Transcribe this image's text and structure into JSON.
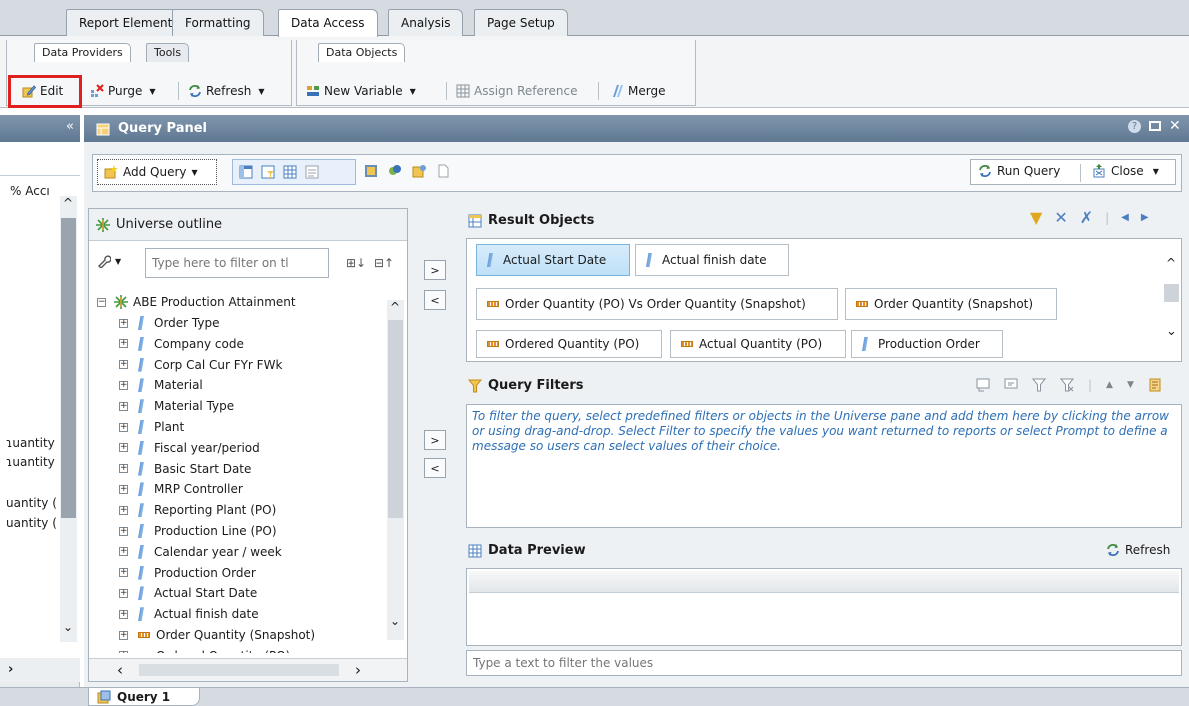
{
  "ribbon_tabs": [
    "Report Elements",
    "Formatting",
    "Data Access",
    "Analysis",
    "Page Setup"
  ],
  "group_tabs": {
    "data_providers": "Data Providers",
    "tools": "Tools",
    "data_objects": "Data Objects"
  },
  "ribbon_buttons": {
    "edit": "Edit",
    "purge": "Purge",
    "refresh": "Refresh",
    "new_variable": "New Variable",
    "assign_reference": "Assign Reference",
    "merge": "Merge"
  },
  "left_pane": {
    "collapse_glyph": "«",
    "labels": [
      "% Accı",
      "ɿuantity",
      "ɿuantity",
      "uantity (",
      "uantity ("
    ]
  },
  "query_panel": {
    "title": "Query Panel",
    "add_query": "Add Query",
    "run_query": "Run Query",
    "close": "Close",
    "universe": {
      "title": "Universe outline",
      "filter_placeholder": "Type here to filter on tl",
      "root": "ABE Production Attainment",
      "items": [
        {
          "label": "Order Type",
          "kind": "dimension"
        },
        {
          "label": "Company code",
          "kind": "dimension"
        },
        {
          "label": "Corp Cal Cur FYr FWk",
          "kind": "dimension"
        },
        {
          "label": "Material",
          "kind": "dimension"
        },
        {
          "label": "Material Type",
          "kind": "dimension"
        },
        {
          "label": "Plant",
          "kind": "dimension"
        },
        {
          "label": "Fiscal year/period",
          "kind": "dimension"
        },
        {
          "label": "Basic Start Date",
          "kind": "dimension"
        },
        {
          "label": "MRP Controller",
          "kind": "dimension"
        },
        {
          "label": "Reporting Plant (PO)",
          "kind": "dimension"
        },
        {
          "label": "Production Line (PO)",
          "kind": "dimension"
        },
        {
          "label": "Calendar year / week",
          "kind": "dimension"
        },
        {
          "label": "Production Order",
          "kind": "dimension"
        },
        {
          "label": "Actual Start Date",
          "kind": "dimension"
        },
        {
          "label": "Actual finish date",
          "kind": "dimension"
        },
        {
          "label": "Order Quantity (Snapshot)",
          "kind": "measure"
        },
        {
          "label": "Ordered Quantity (PO)",
          "kind": "measure"
        }
      ]
    },
    "result_objects": {
      "title": "Result Objects",
      "chips": [
        {
          "label": "Actual Start Date",
          "kind": "dimension",
          "selected": true
        },
        {
          "label": "Actual finish date",
          "kind": "dimension",
          "selected": false
        },
        {
          "label": "Order Quantity (PO) Vs Order Quantity (Snapshot)",
          "kind": "measure",
          "selected": false
        },
        {
          "label": "Order Quantity (Snapshot)",
          "kind": "measure",
          "selected": false
        },
        {
          "label": "Ordered Quantity (PO)",
          "kind": "measure",
          "selected": false
        },
        {
          "label": "Actual Quantity (PO)",
          "kind": "measure",
          "selected": false
        },
        {
          "label": "Production Order",
          "kind": "dimension",
          "selected": false
        }
      ]
    },
    "query_filters": {
      "title": "Query Filters",
      "hint": "To filter the query, select predefined filters or objects in the Universe pane and add them here by clicking the arrow or using drag-and-drop. Select Filter to specify the values you want returned to reports or select Prompt to define a message so users can select values of their choice."
    },
    "data_preview": {
      "title": "Data Preview",
      "refresh": "Refresh",
      "filter_placeholder": "Type a text to filter the values"
    }
  },
  "bottom_tab": "Query 1",
  "colors": {
    "accent": "#5f7891",
    "highlight": "#e02020",
    "filter_hint": "#2d6fb5"
  }
}
